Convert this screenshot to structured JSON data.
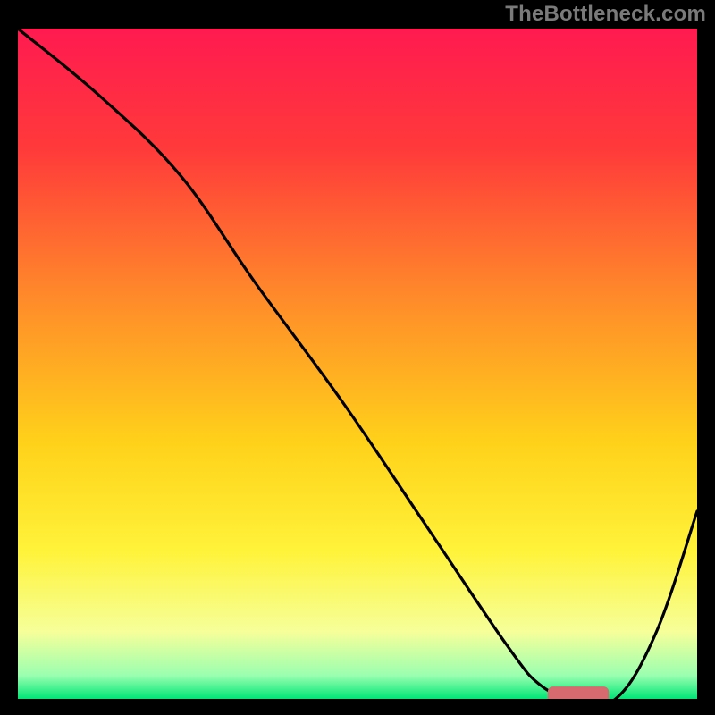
{
  "watermark": "TheBottleneck.com",
  "chart_data": {
    "type": "line",
    "title": "",
    "xlabel": "",
    "ylabel": "",
    "xlim": [
      0,
      100
    ],
    "ylim": [
      0,
      100
    ],
    "gradient_stops": [
      {
        "offset": 0.0,
        "color": "#ff1a50"
      },
      {
        "offset": 0.18,
        "color": "#ff3a3a"
      },
      {
        "offset": 0.4,
        "color": "#ff8a2a"
      },
      {
        "offset": 0.62,
        "color": "#ffd21a"
      },
      {
        "offset": 0.78,
        "color": "#fff33a"
      },
      {
        "offset": 0.9,
        "color": "#f6ff9a"
      },
      {
        "offset": 0.965,
        "color": "#9affb0"
      },
      {
        "offset": 1.0,
        "color": "#00e676"
      }
    ],
    "series": [
      {
        "name": "curve",
        "color": "#000000",
        "x": [
          0,
          12,
          24,
          35,
          48,
          60,
          72,
          77,
          82,
          88,
          94,
          100
        ],
        "y": [
          100,
          90,
          78,
          62,
          44,
          26,
          8,
          2,
          0,
          0,
          10,
          28
        ]
      }
    ],
    "marker": {
      "name": "optimal-range",
      "color": "#d66a6f",
      "x_start": 78,
      "x_end": 87,
      "y": 0.6,
      "thickness": 2.5
    }
  }
}
